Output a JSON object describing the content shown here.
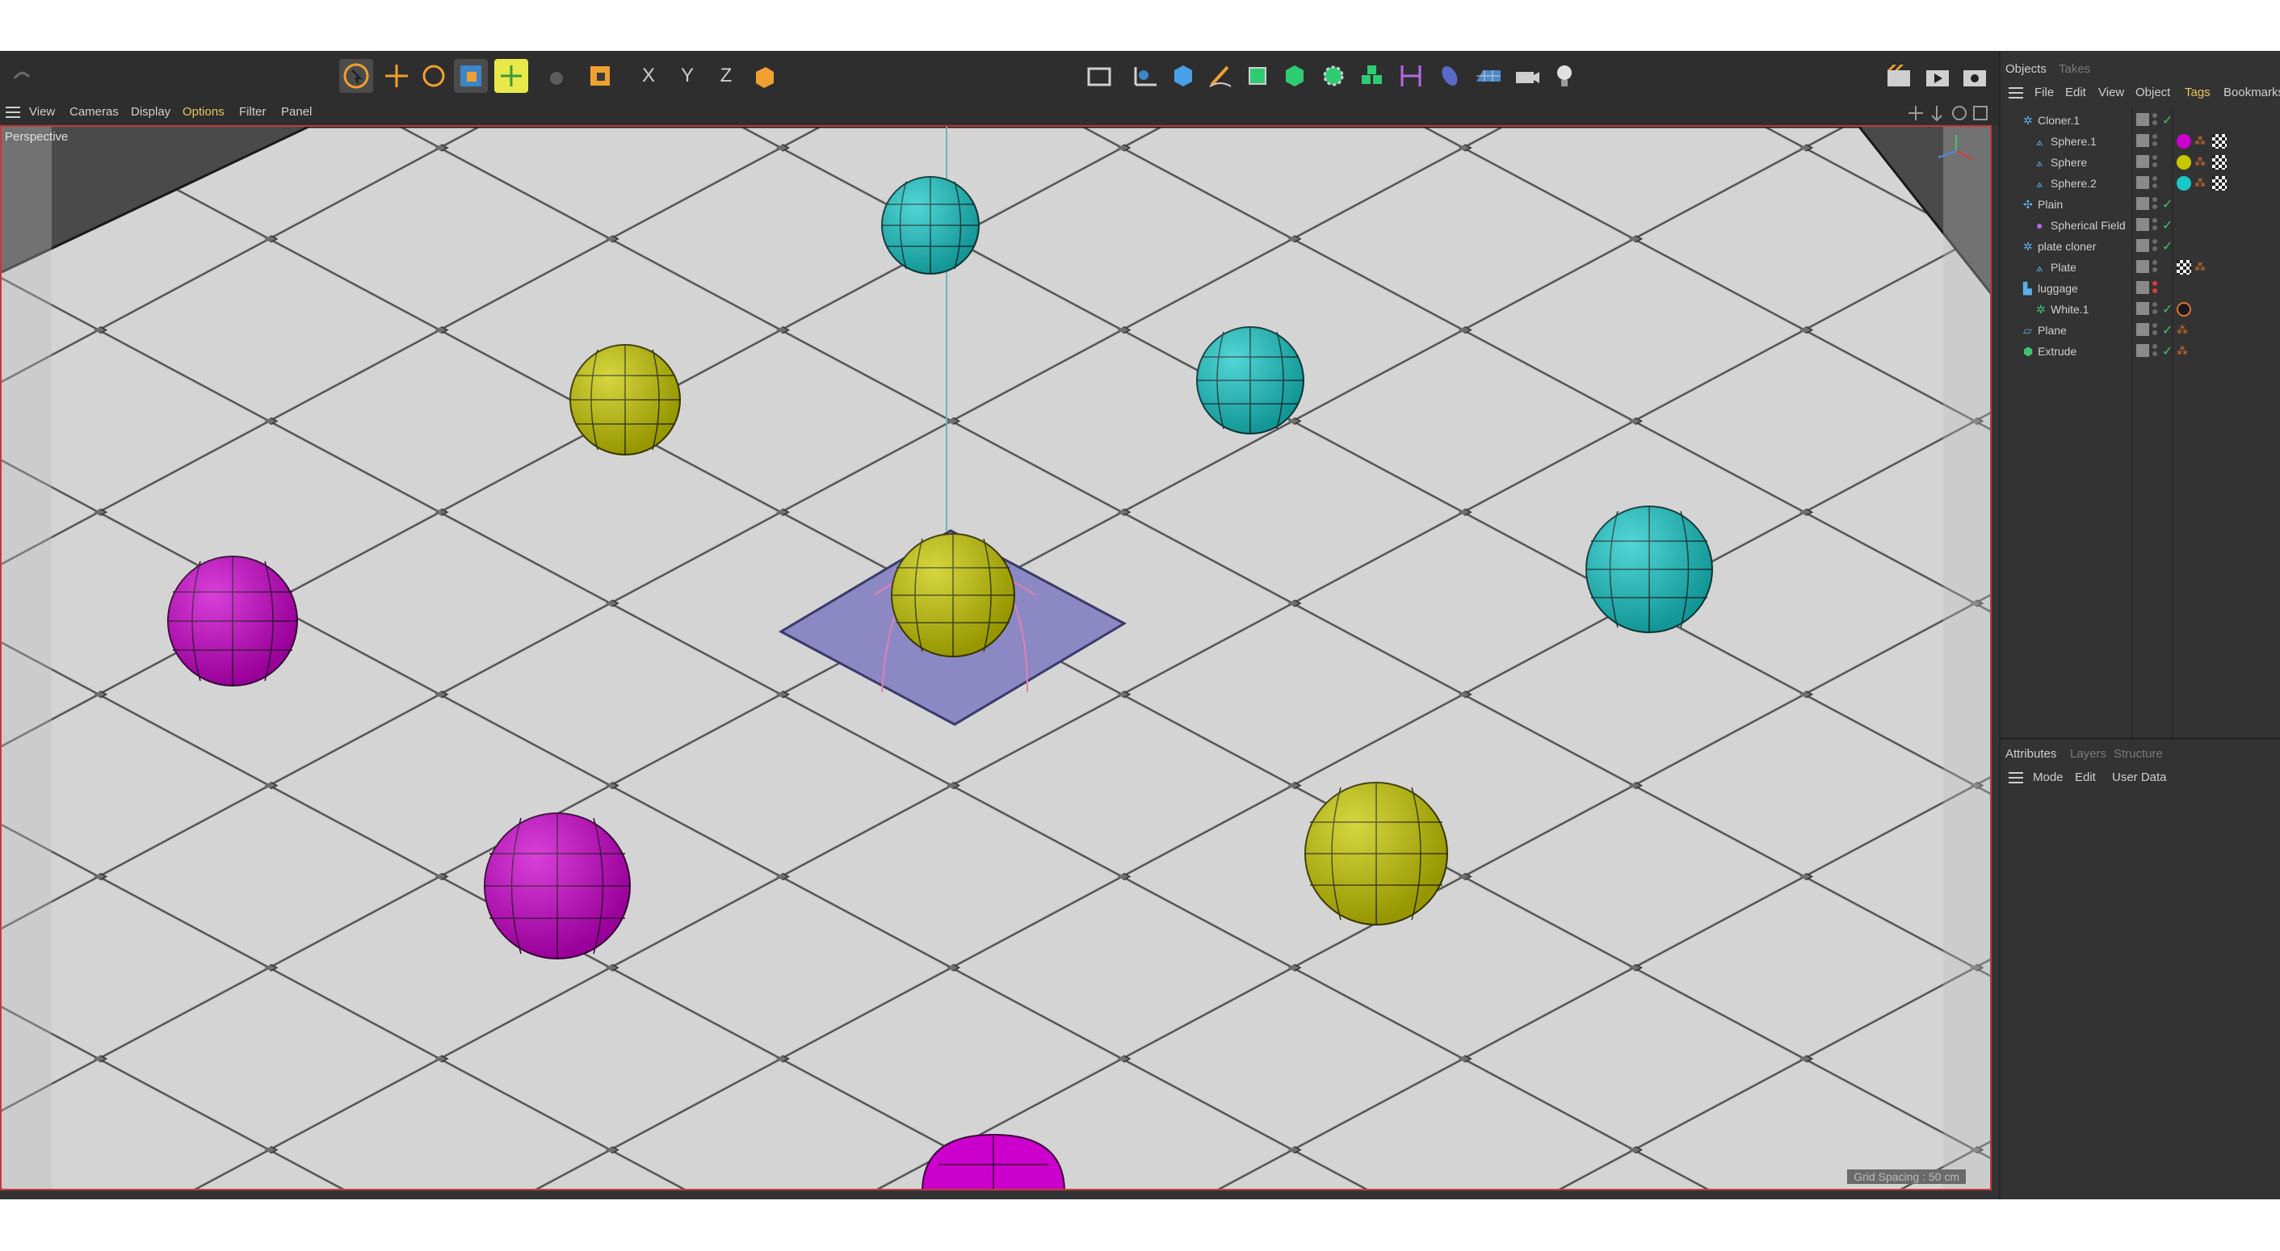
{
  "toolbar": {
    "tools": [
      {
        "name": "undo-icon"
      },
      {
        "name": "select-icon"
      },
      {
        "name": "move-icon"
      },
      {
        "name": "rotate-icon"
      },
      {
        "name": "scale-icon"
      },
      {
        "name": "live-select-icon"
      },
      {
        "name": "hand-icon"
      },
      {
        "name": "model-mode-icon"
      },
      {
        "name": "x-axis-icon",
        "label": "X"
      },
      {
        "name": "y-axis-icon",
        "label": "Y"
      },
      {
        "name": "z-axis-icon",
        "label": "Z"
      },
      {
        "name": "coordinate-system-icon"
      },
      {
        "name": "render-region-icon"
      },
      {
        "name": "spline-icon"
      },
      {
        "name": "cube-icon"
      },
      {
        "name": "pen-icon"
      },
      {
        "name": "subdivision-icon"
      },
      {
        "name": "extrude-icon"
      },
      {
        "name": "cloner-icon"
      },
      {
        "name": "mograph-icon"
      },
      {
        "name": "deformer-icon"
      },
      {
        "name": "field-icon"
      },
      {
        "name": "floor-icon"
      },
      {
        "name": "camera-icon"
      },
      {
        "name": "light-icon"
      },
      {
        "name": "render-view-icon"
      },
      {
        "name": "render-picture-icon"
      },
      {
        "name": "render-settings-icon"
      }
    ],
    "colors": {
      "accent": "#f0a030",
      "highlight": "#e8e84a"
    }
  },
  "viewport_menu": [
    "View",
    "Cameras",
    "Display",
    "Options",
    "Filter",
    "Panel"
  ],
  "viewport": {
    "label": "Perspective",
    "grid_spacing": "Grid Spacing : 50 cm"
  },
  "objects_panel": {
    "tabs": [
      "Objects",
      "Takes"
    ],
    "menu": [
      "File",
      "Edit",
      "View",
      "Object",
      "Tags",
      "Bookmarks"
    ],
    "items": [
      {
        "name": "Cloner.1",
        "indent": 0
      },
      {
        "name": "Sphere.1",
        "indent": 1
      },
      {
        "name": "Sphere",
        "indent": 1
      },
      {
        "name": "Sphere.2",
        "indent": 1
      },
      {
        "name": "Plain",
        "indent": 0
      },
      {
        "name": "Spherical Field",
        "indent": 1
      },
      {
        "name": "plate cloner",
        "indent": 0
      },
      {
        "name": "Plate",
        "indent": 1
      },
      {
        "name": "luggage",
        "indent": 0
      },
      {
        "name": "White.1",
        "indent": 1
      },
      {
        "name": "Plane",
        "indent": 0
      },
      {
        "name": "Extrude",
        "indent": 0
      }
    ]
  },
  "attributes_panel": {
    "tabs": [
      "Attributes",
      "Layers",
      "Structure"
    ],
    "menu": [
      "Mode",
      "Edit",
      "User Data"
    ]
  },
  "sphere_colors": {
    "cyan": "#18c8c8",
    "yellow": "#c8c800",
    "magenta": "#cc00cc"
  }
}
